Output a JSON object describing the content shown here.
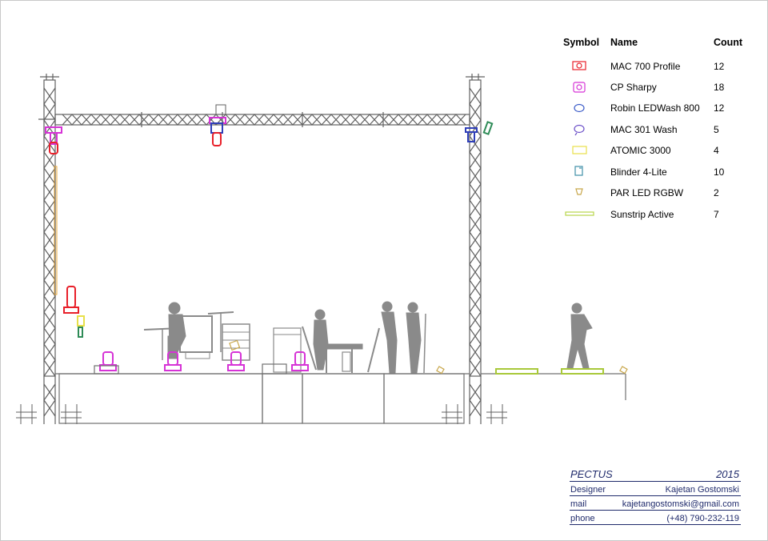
{
  "legend": {
    "headers": {
      "symbol": "Symbol",
      "name": "Name",
      "count": "Count"
    },
    "items": [
      {
        "name": "MAC 700 Profile",
        "count": "12",
        "icon": "mac700-profile-icon",
        "color": "#e8202a"
      },
      {
        "name": "CP Sharpy",
        "count": "18",
        "icon": "cp-sharpy-icon",
        "color": "#d633d6"
      },
      {
        "name": "Robin LEDWash 800",
        "count": "12",
        "icon": "robin-ledwash-icon",
        "color": "#3b5bc8"
      },
      {
        "name": "MAC 301 Wash",
        "count": "5",
        "icon": "mac301-wash-icon",
        "color": "#6b4fc8"
      },
      {
        "name": "ATOMIC 3000",
        "count": "4",
        "icon": "atomic-strobe-icon",
        "color": "#e8e04a"
      },
      {
        "name": "Blinder 4-Lite",
        "count": "10",
        "icon": "blinder-icon",
        "color": "#3f8fa8"
      },
      {
        "name": "PAR LED RGBW",
        "count": "2",
        "icon": "par-led-icon",
        "color": "#c8a64a"
      },
      {
        "name": "Sunstrip Active",
        "count": "7",
        "icon": "sunstrip-icon",
        "color": "#b8d64a"
      }
    ]
  },
  "titleblock": {
    "project": "PECTUS",
    "year": "2015",
    "designer_label": "Designer",
    "designer": "Kajetan Gostomski",
    "mail_label": "mail",
    "mail": "kajetangostomski@gmail.com",
    "phone_label": "phone",
    "phone": "(+48) 790-232-119"
  },
  "colors": {
    "truss": "#606060",
    "stage": "#707070",
    "silhouette": "#8a8a8a",
    "profile": "#e8202a",
    "sharpy": "#d633d6",
    "wash": "#2f3fb8",
    "sunstrip": "#a8c83a",
    "blinder": "#2e8b57",
    "title": "#1f2a6b"
  }
}
